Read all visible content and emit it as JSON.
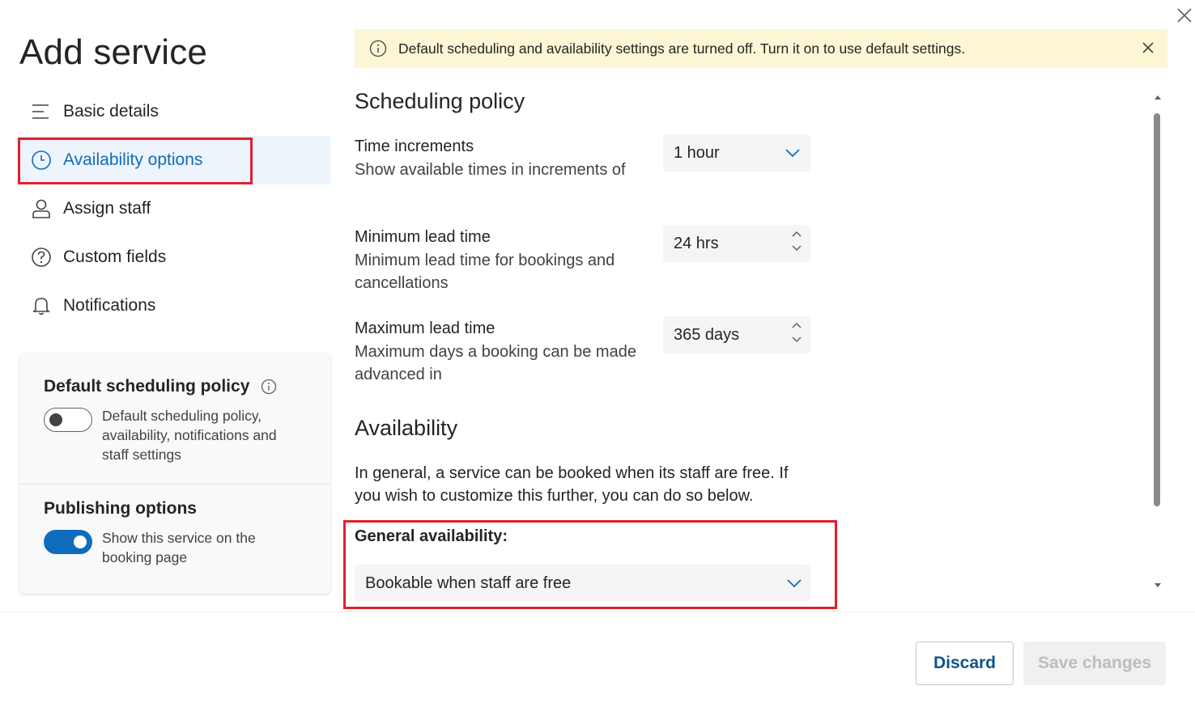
{
  "page": {
    "title": "Add service"
  },
  "nav": {
    "items": [
      {
        "label": "Basic details",
        "icon": "list-icon"
      },
      {
        "label": "Availability options",
        "icon": "clock-icon",
        "active": true
      },
      {
        "label": "Assign staff",
        "icon": "person-icon"
      },
      {
        "label": "Custom fields",
        "icon": "question-icon"
      },
      {
        "label": "Notifications",
        "icon": "bell-icon"
      }
    ]
  },
  "card": {
    "default_policy": {
      "title": "Default scheduling policy",
      "toggle_on": false,
      "toggle_text": "Default scheduling policy, availability, notifications and staff settings"
    },
    "publishing": {
      "title": "Publishing options",
      "toggle_on": true,
      "toggle_text": "Show this service on the booking page"
    }
  },
  "banner": {
    "text": "Default scheduling and availability settings are turned off. Turn it on to use default settings.",
    "background": "#fdf6d4"
  },
  "scheduling": {
    "title": "Scheduling policy",
    "time_increments": {
      "label": "Time increments",
      "desc": "Show available times in increments of",
      "value": "1 hour"
    },
    "min_lead": {
      "label": "Minimum lead time",
      "desc": "Minimum lead time for bookings and cancellations",
      "value": "24 hrs"
    },
    "max_lead": {
      "label": "Maximum lead time",
      "desc": "Maximum days a booking can be made advanced in",
      "value": "365 days"
    }
  },
  "availability": {
    "title": "Availability",
    "body": "In general, a service can be booked when its staff are free. If you wish to customize this further, you can do so below.",
    "general_label": "General availability:",
    "general_value": "Bookable when staff are free"
  },
  "footer": {
    "discard": "Discard",
    "save": "Save changes"
  },
  "colors": {
    "accent": "#0f6cbd",
    "highlight": "#e0202c",
    "active_nav_bg": "#eef4fc"
  }
}
